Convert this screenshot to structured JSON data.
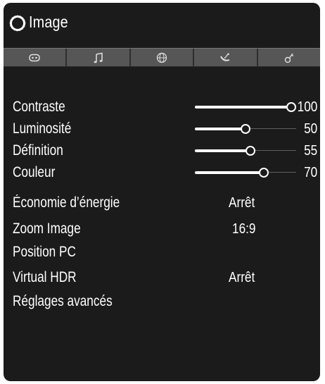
{
  "menu": {
    "title": "Image"
  },
  "tabs": [
    {
      "icon": "picture-icon"
    },
    {
      "icon": "music-note-icon"
    },
    {
      "icon": "globe-icon"
    },
    {
      "icon": "satellite-dish-icon"
    },
    {
      "icon": "settings-key-icon"
    }
  ],
  "settings": {
    "contrast": {
      "label": "Contraste",
      "value": "100",
      "level": 100
    },
    "brightness": {
      "label": "Luminosité",
      "value": "50",
      "level": 50
    },
    "sharpness": {
      "label": "Définition",
      "value": "55",
      "level": 55
    },
    "color": {
      "label": "Couleur",
      "value": "70",
      "level": 70
    },
    "energy_saving": {
      "label": "Économie d’énergie",
      "value": "Arrêt"
    },
    "zoom": {
      "label": "Zoom Image",
      "value": "16:9"
    },
    "pc_position": {
      "label": "Position PC"
    },
    "virtual_hdr": {
      "label": "Virtual HDR",
      "value": "Arrêt"
    },
    "advanced": {
      "label": "Réglages avancés"
    }
  },
  "colors": {
    "background": "#1b1b1b",
    "tab_bar": "#565656",
    "text": "#ffffff"
  }
}
